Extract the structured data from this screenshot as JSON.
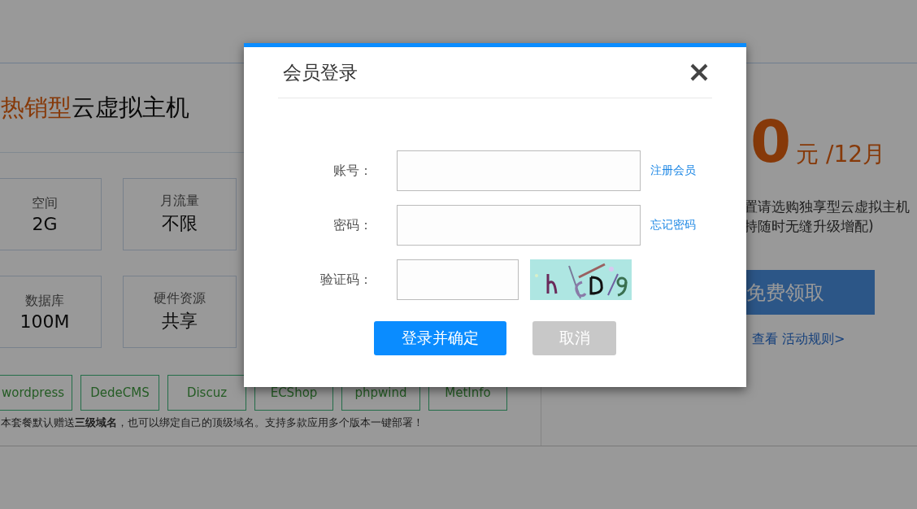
{
  "page": {
    "product_title": {
      "highlight": "热销型",
      "rest": "云虚拟主机"
    },
    "specs": [
      {
        "label": "空间",
        "value": "2G"
      },
      {
        "label": "月流量",
        "value": "不限"
      },
      {
        "label": "数据库",
        "value": "100M"
      },
      {
        "label": "硬件资源",
        "value": "共享"
      }
    ],
    "apps": [
      "wordpress",
      "DedeCMS",
      "Discuz",
      "ECShop",
      "phpwind",
      "MetInfo"
    ],
    "note": "本套餐默认赠送**三级域名**，也可以绑定自己的顶级域名。支持多款应用多个版本一键部署！",
    "price": {
      "amount": "0",
      "unit": "元 /12月"
    },
    "description": [
      "置请选购独享型云虚拟主机",
      "持随时无缝升级增配)"
    ],
    "claim_button": "免费领取",
    "rules_link": "查看 活动规则>"
  },
  "dialog": {
    "title": "会员登录",
    "fields": [
      {
        "kind": "text",
        "label": "账号：",
        "link": "注册会员"
      },
      {
        "kind": "text",
        "label": "密码：",
        "link": "忘记密码"
      },
      {
        "kind": "captcha",
        "label": "验证码："
      }
    ],
    "buttons": [
      {
        "kind": "primary",
        "label": "登录并确定"
      },
      {
        "kind": "secondary",
        "label": "取消"
      }
    ]
  }
}
